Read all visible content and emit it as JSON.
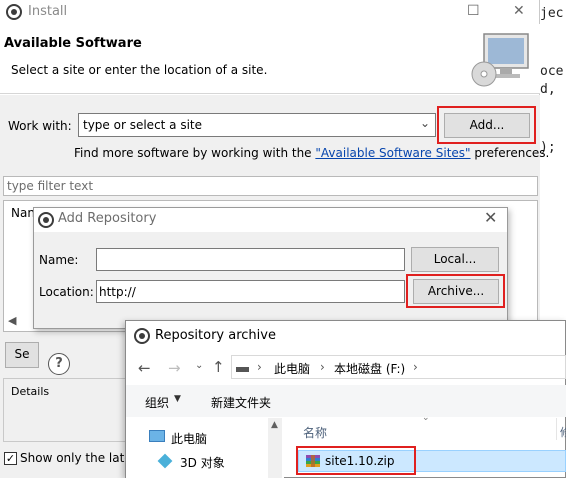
{
  "background_editor": {
    "lines": [
      "jec",
      "oce",
      "d,",
      ");"
    ]
  },
  "install": {
    "title": "Install",
    "minimize_glyph": "☐",
    "close_glyph": "✕",
    "heading": "Available Software",
    "subheading": "Select a site or enter the location of a site.",
    "work_with_label": "Work with:",
    "work_with_value": "type or select a site",
    "add_button": "Add...",
    "find_more_prefix": "Find more software by working with the ",
    "find_more_link": "\"Available Software Sites\"",
    "find_more_suffix": " preferences.",
    "filter_placeholder": "type filter text",
    "tree_header": "Nan",
    "select_button_partial": "Se",
    "help_glyph": "?",
    "details_label": "Details",
    "show_latest_label": "Show only the late"
  },
  "add_repository": {
    "title": "Add Repository",
    "close_glyph": "✕",
    "name_label": "Name:",
    "name_value": "",
    "local_button": "Local...",
    "location_label": "Location:",
    "location_value": "http://",
    "archive_button": "Archive..."
  },
  "repository_archive": {
    "title": "Repository archive",
    "breadcrumb": [
      "此电脑",
      "本地磁盘 (F:)"
    ],
    "organize_label": "组织",
    "new_folder_label": "新建文件夹",
    "nav_items": [
      {
        "label": "此电脑",
        "icon": "computer-icon"
      },
      {
        "label": "3D 对象",
        "icon": "3d-objects-icon"
      }
    ],
    "column_name": "名称",
    "files": [
      {
        "name": "site1.10.zip",
        "icon": "zip-archive-icon",
        "selected": true
      }
    ]
  },
  "colors": {
    "highlight_red": "#e0201f",
    "link_blue": "#0645ad",
    "selection_blue": "#cce8ff"
  }
}
